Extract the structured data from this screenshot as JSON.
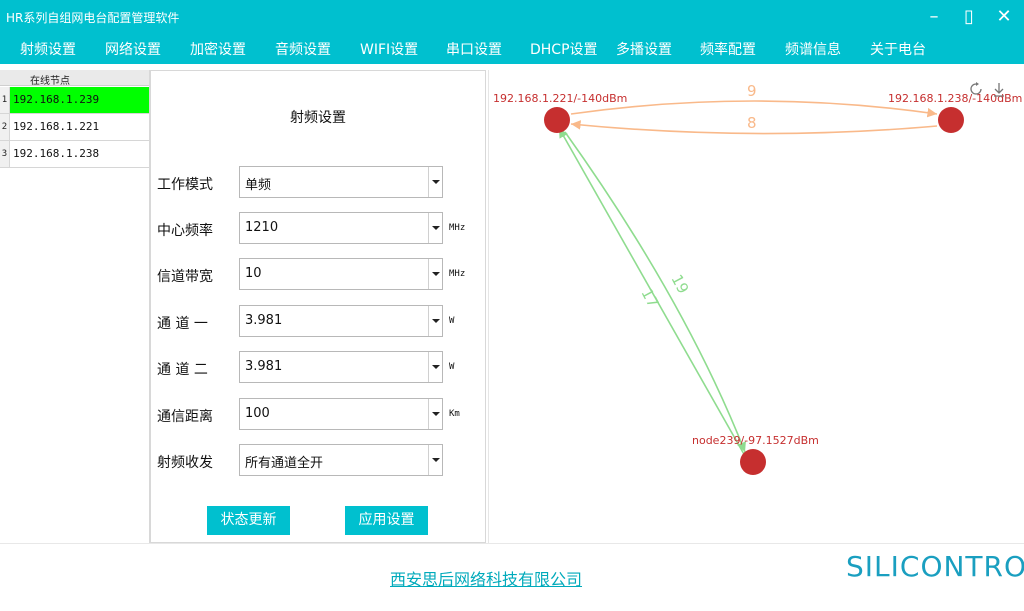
{
  "window": {
    "title": "HR系列自组网电台配置管理软件",
    "minimize_glyph": "–",
    "maximize_glyph": "▯",
    "close_glyph": "✕"
  },
  "menu": {
    "items": [
      "射频设置",
      "网络设置",
      "加密设置",
      "音频设置",
      "WIFI设置",
      "串口设置",
      "DHCP设置",
      "多播设置",
      "频率配置",
      "频谱信息",
      "关于电台"
    ]
  },
  "nodes": {
    "header": "在线节点",
    "rows": [
      {
        "index": "1",
        "ip": "192.168.1.239",
        "selected": true
      },
      {
        "index": "2",
        "ip": "192.168.1.221",
        "selected": false
      },
      {
        "index": "3",
        "ip": "192.168.1.238",
        "selected": false
      }
    ]
  },
  "rf_settings": {
    "title": "射频设置",
    "fields": [
      {
        "label": "工作模式",
        "value": "单频",
        "unit": ""
      },
      {
        "label": "中心频率",
        "value": "1210",
        "unit": "MHz"
      },
      {
        "label": "信道带宽",
        "value": "10",
        "unit": "MHz"
      },
      {
        "label": "通 道 一",
        "value": "3.981",
        "unit": "W"
      },
      {
        "label": "通 道 二",
        "value": "3.981",
        "unit": "W"
      },
      {
        "label": "通信距离",
        "value": "100",
        "unit": "Km"
      },
      {
        "label": "射频收发",
        "value": "所有通道全开",
        "unit": ""
      }
    ],
    "refresh_button": "状态更新",
    "apply_button": "应用设置"
  },
  "topology": {
    "nodes": [
      {
        "label": "192.168.1.221/-140dBm"
      },
      {
        "label": "192.168.1.238/-140dBm"
      },
      {
        "label": "node239/-97.1527dBm"
      }
    ],
    "links": [
      {
        "label": "9",
        "color": "#f9b98a"
      },
      {
        "label": "8",
        "color": "#f9b98a"
      },
      {
        "label": "19",
        "color": "#8fdc8f"
      },
      {
        "label": "17",
        "color": "#8fdc8f"
      }
    ],
    "node_color": "#c62f2f",
    "toolbar_icons": [
      "refresh-icon",
      "download-icon"
    ]
  },
  "footer": {
    "company": "西安思后网络科技有限公司",
    "brand": "SILICONTROL"
  },
  "colors": {
    "accent": "#00c0cf",
    "selected_row": "#00ff00"
  }
}
